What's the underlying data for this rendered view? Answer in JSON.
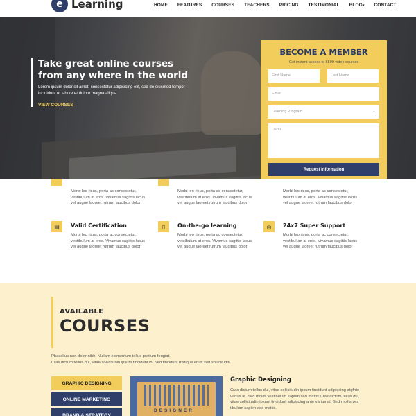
{
  "header": {
    "logo_letter": "e",
    "logo_text": "Learning",
    "nav": [
      "HOME",
      "FEATURES",
      "COURSES",
      "TEACHERS",
      "PRICING",
      "TESTIMONIAL",
      "BLOG",
      "CONTACT"
    ]
  },
  "hero": {
    "title": "Take great online courses from any where in the world",
    "description": "Lorem ipsum dolor sit amet, consectetur adipisicing elit, sed do eiusmod tempor incididunt ut labore et dolore magna aliqua.",
    "link": "VIEW COURSES"
  },
  "member": {
    "title": "BECOME A MEMBER",
    "subtitle": "Get instant access to 6500 video courses",
    "first_name": "First Name",
    "last_name": "Last Name",
    "email": "Email",
    "program": "Learning Program",
    "detail": "Detail",
    "submit": "Request Information"
  },
  "features": {
    "lorem": "Morbi leo risus, porta ac consectetur, vestibulum at eros. Vivamus sagittis lacus vel augue laoreet rutrum faucibus dolor",
    "items": [
      {
        "title": "Valid Certification",
        "icon": "certificate-icon"
      },
      {
        "title": "On-the-go learning",
        "icon": "mobile-icon"
      },
      {
        "title": "24x7 Super Support",
        "icon": "lifebuoy-icon"
      }
    ]
  },
  "courses": {
    "available": "AVAILABLE",
    "title": "COURSES",
    "desc1": "Phasellus non dolor nibh. Nullam elementum tellus pretium feugiat.",
    "desc2": "Cras dictum tellus dui, vitae sollicitudin ipsum tincidunt in. Sed tincidunt tristique enim sed sollicitudin.",
    "categories": [
      "GRAPHIC DESIGNING",
      "ONLINE MARKETING",
      "BRAND & STRATEGY"
    ],
    "image_word": "DESIGNER",
    "selected": {
      "name": "Graphic Designing",
      "text": "Cras dictum tellus dui, vitae sollicitudin ipsum tincidunt adipiscing atgfnte varius at. Sed mollis vestibulum sapien sed mattis.Cras dictum tellus dui, vitae sollicitudin ipsum tincidunt adipiscing ante varius at. Sed mollis ves tibulum sapien sed mattis."
    }
  },
  "colors": {
    "accent": "#f2cd5c",
    "navy": "#2f3f6a",
    "cream": "#fdf1cd"
  }
}
